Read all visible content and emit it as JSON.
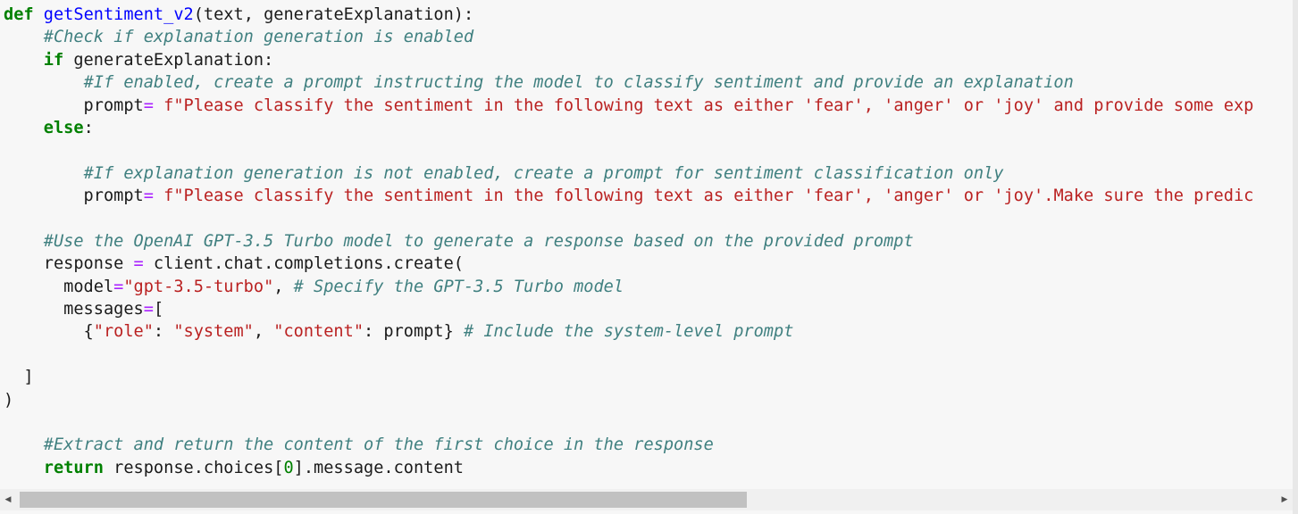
{
  "code": {
    "lines": [
      [
        {
          "t": "kw",
          "v": "def"
        },
        {
          "t": "",
          "v": " "
        },
        {
          "t": "fn",
          "v": "getSentiment_v2"
        },
        {
          "t": "",
          "v": "(text, generateExplanation):"
        }
      ],
      [
        {
          "t": "",
          "v": "    "
        },
        {
          "t": "cm",
          "v": "#Check if explanation generation is enabled"
        }
      ],
      [
        {
          "t": "",
          "v": "    "
        },
        {
          "t": "kw",
          "v": "if"
        },
        {
          "t": "",
          "v": " generateExplanation:"
        }
      ],
      [
        {
          "t": "",
          "v": "        "
        },
        {
          "t": "cm",
          "v": "#If enabled, create a prompt instructing the model to classify sentiment and provide an explanation"
        }
      ],
      [
        {
          "t": "",
          "v": "        prompt"
        },
        {
          "t": "op",
          "v": "="
        },
        {
          "t": "",
          "v": " "
        },
        {
          "t": "st",
          "v": "f\"Please classify the sentiment in the following text as either 'fear', 'anger' or 'joy' and provide some exp"
        }
      ],
      [
        {
          "t": "",
          "v": "    "
        },
        {
          "t": "kw",
          "v": "else"
        },
        {
          "t": "",
          "v": ":"
        }
      ],
      [
        {
          "t": "",
          "v": ""
        }
      ],
      [
        {
          "t": "",
          "v": "        "
        },
        {
          "t": "cm",
          "v": "#If explanation generation is not enabled, create a prompt for sentiment classification only"
        }
      ],
      [
        {
          "t": "",
          "v": "        prompt"
        },
        {
          "t": "op",
          "v": "="
        },
        {
          "t": "",
          "v": " "
        },
        {
          "t": "st",
          "v": "f\"Please classify the sentiment in the following text as either 'fear', 'anger' or 'joy'.Make sure the predic"
        }
      ],
      [
        {
          "t": "",
          "v": ""
        }
      ],
      [
        {
          "t": "",
          "v": "    "
        },
        {
          "t": "cm",
          "v": "#Use the OpenAI GPT-3.5 Turbo model to generate a response based on the provided prompt"
        }
      ],
      [
        {
          "t": "",
          "v": "    response "
        },
        {
          "t": "op",
          "v": "="
        },
        {
          "t": "",
          "v": " client.chat.completions.create("
        }
      ],
      [
        {
          "t": "",
          "v": "      model"
        },
        {
          "t": "op",
          "v": "="
        },
        {
          "t": "st",
          "v": "\"gpt-3.5-turbo\""
        },
        {
          "t": "",
          "v": ", "
        },
        {
          "t": "cm",
          "v": "# Specify the GPT-3.5 Turbo model"
        }
      ],
      [
        {
          "t": "",
          "v": "      messages"
        },
        {
          "t": "op",
          "v": "="
        },
        {
          "t": "",
          "v": "["
        }
      ],
      [
        {
          "t": "",
          "v": "        {"
        },
        {
          "t": "st",
          "v": "\"role\""
        },
        {
          "t": "",
          "v": ": "
        },
        {
          "t": "st",
          "v": "\"system\""
        },
        {
          "t": "",
          "v": ", "
        },
        {
          "t": "st",
          "v": "\"content\""
        },
        {
          "t": "",
          "v": ": prompt} "
        },
        {
          "t": "cm",
          "v": "# Include the system-level prompt"
        }
      ],
      [
        {
          "t": "",
          "v": ""
        }
      ],
      [
        {
          "t": "",
          "v": "  ]"
        }
      ],
      [
        {
          "t": "",
          "v": ")"
        }
      ],
      [
        {
          "t": "",
          "v": ""
        }
      ],
      [
        {
          "t": "",
          "v": "    "
        },
        {
          "t": "cm",
          "v": "#Extract and return the content of the first choice in the response"
        }
      ],
      [
        {
          "t": "",
          "v": "    "
        },
        {
          "t": "kw",
          "v": "return"
        },
        {
          "t": "",
          "v": " response.choices["
        },
        {
          "t": "nm",
          "v": "0"
        },
        {
          "t": "",
          "v": "].message.content"
        }
      ]
    ]
  },
  "scrollbar": {
    "left_arrow": "◀",
    "right_arrow": "▶",
    "thumb_fraction": 0.58
  }
}
